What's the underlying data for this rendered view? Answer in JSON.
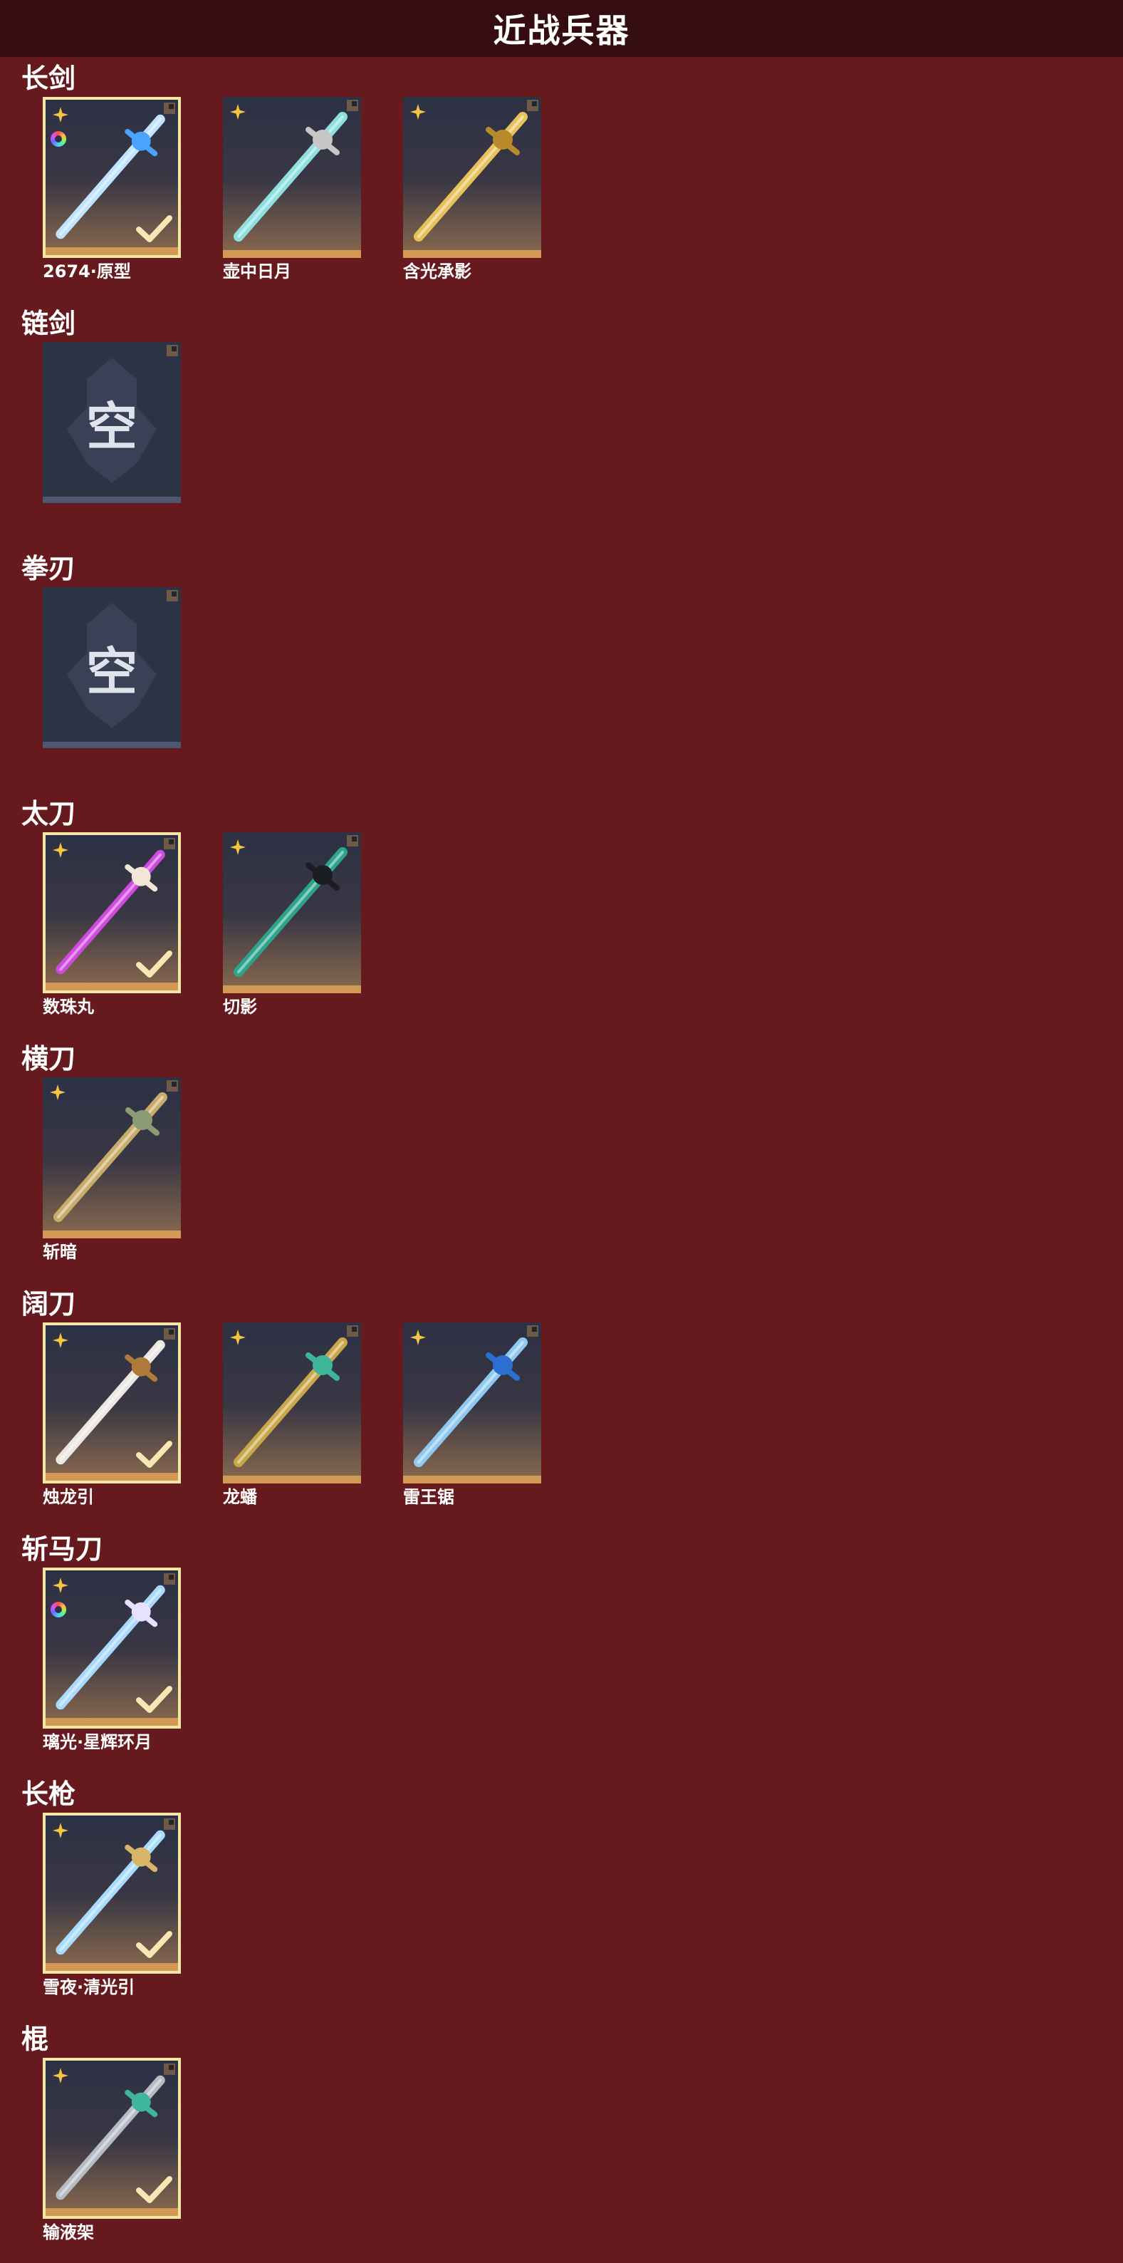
{
  "page": {
    "title": "近战兵器"
  },
  "sections": [
    {
      "title": "长剑",
      "items": [
        {
          "label": "2674·原型",
          "selected": true,
          "empty": false,
          "color_variant": true,
          "art_color": "#bfe4ff",
          "accent_color": "#4aa3ff"
        },
        {
          "label": "壶中日月",
          "selected": false,
          "empty": false,
          "color_variant": false,
          "art_color": "#8ee0e0",
          "accent_color": "#c7c7c7"
        },
        {
          "label": "含光承影",
          "selected": false,
          "empty": false,
          "color_variant": false,
          "art_color": "#e7c25a",
          "accent_color": "#b88a2a"
        }
      ]
    },
    {
      "title": "链剑",
      "items": [
        {
          "label": "",
          "selected": false,
          "empty": true,
          "empty_glyph": "空"
        }
      ]
    },
    {
      "title": "拳刃",
      "items": [
        {
          "label": "",
          "selected": false,
          "empty": true,
          "empty_glyph": "空"
        }
      ]
    },
    {
      "title": "太刀",
      "items": [
        {
          "label": "数珠丸",
          "selected": true,
          "empty": false,
          "color_variant": false,
          "art_color": "#d04adf",
          "accent_color": "#f2e6d8"
        },
        {
          "label": "切影",
          "selected": false,
          "empty": false,
          "color_variant": false,
          "art_color": "#2aa58c",
          "accent_color": "#1b1d22"
        }
      ]
    },
    {
      "title": "横刀",
      "items": [
        {
          "label": "斩暗",
          "selected": false,
          "empty": false,
          "color_variant": false,
          "art_color": "#c9ab6a",
          "accent_color": "#8c9a76"
        }
      ]
    },
    {
      "title": "阔刀",
      "items": [
        {
          "label": "烛龙引",
          "selected": true,
          "empty": false,
          "color_variant": false,
          "art_color": "#ece7e2",
          "accent_color": "#b07a3a"
        },
        {
          "label": "龙蟠",
          "selected": false,
          "empty": false,
          "color_variant": false,
          "art_color": "#c9a648",
          "accent_color": "#3db59a"
        },
        {
          "label": "雷王锯",
          "selected": false,
          "empty": false,
          "color_variant": false,
          "art_color": "#8fc8f0",
          "accent_color": "#2b6fd0"
        }
      ]
    },
    {
      "title": "斩马刀",
      "items": [
        {
          "label": "璃光·星辉环月",
          "selected": true,
          "empty": false,
          "color_variant": true,
          "art_color": "#a9d9ff",
          "accent_color": "#e8e0ff"
        }
      ]
    },
    {
      "title": "长枪",
      "items": [
        {
          "label": "雪夜·清光引",
          "selected": true,
          "empty": false,
          "color_variant": false,
          "art_color": "#a8dcff",
          "accent_color": "#d9b56a"
        }
      ]
    },
    {
      "title": "棍",
      "items": [
        {
          "label": "输液架",
          "selected": true,
          "empty": false,
          "color_variant": false,
          "art_color": "#b7bcc4",
          "accent_color": "#3fb59b"
        }
      ]
    }
  ]
}
